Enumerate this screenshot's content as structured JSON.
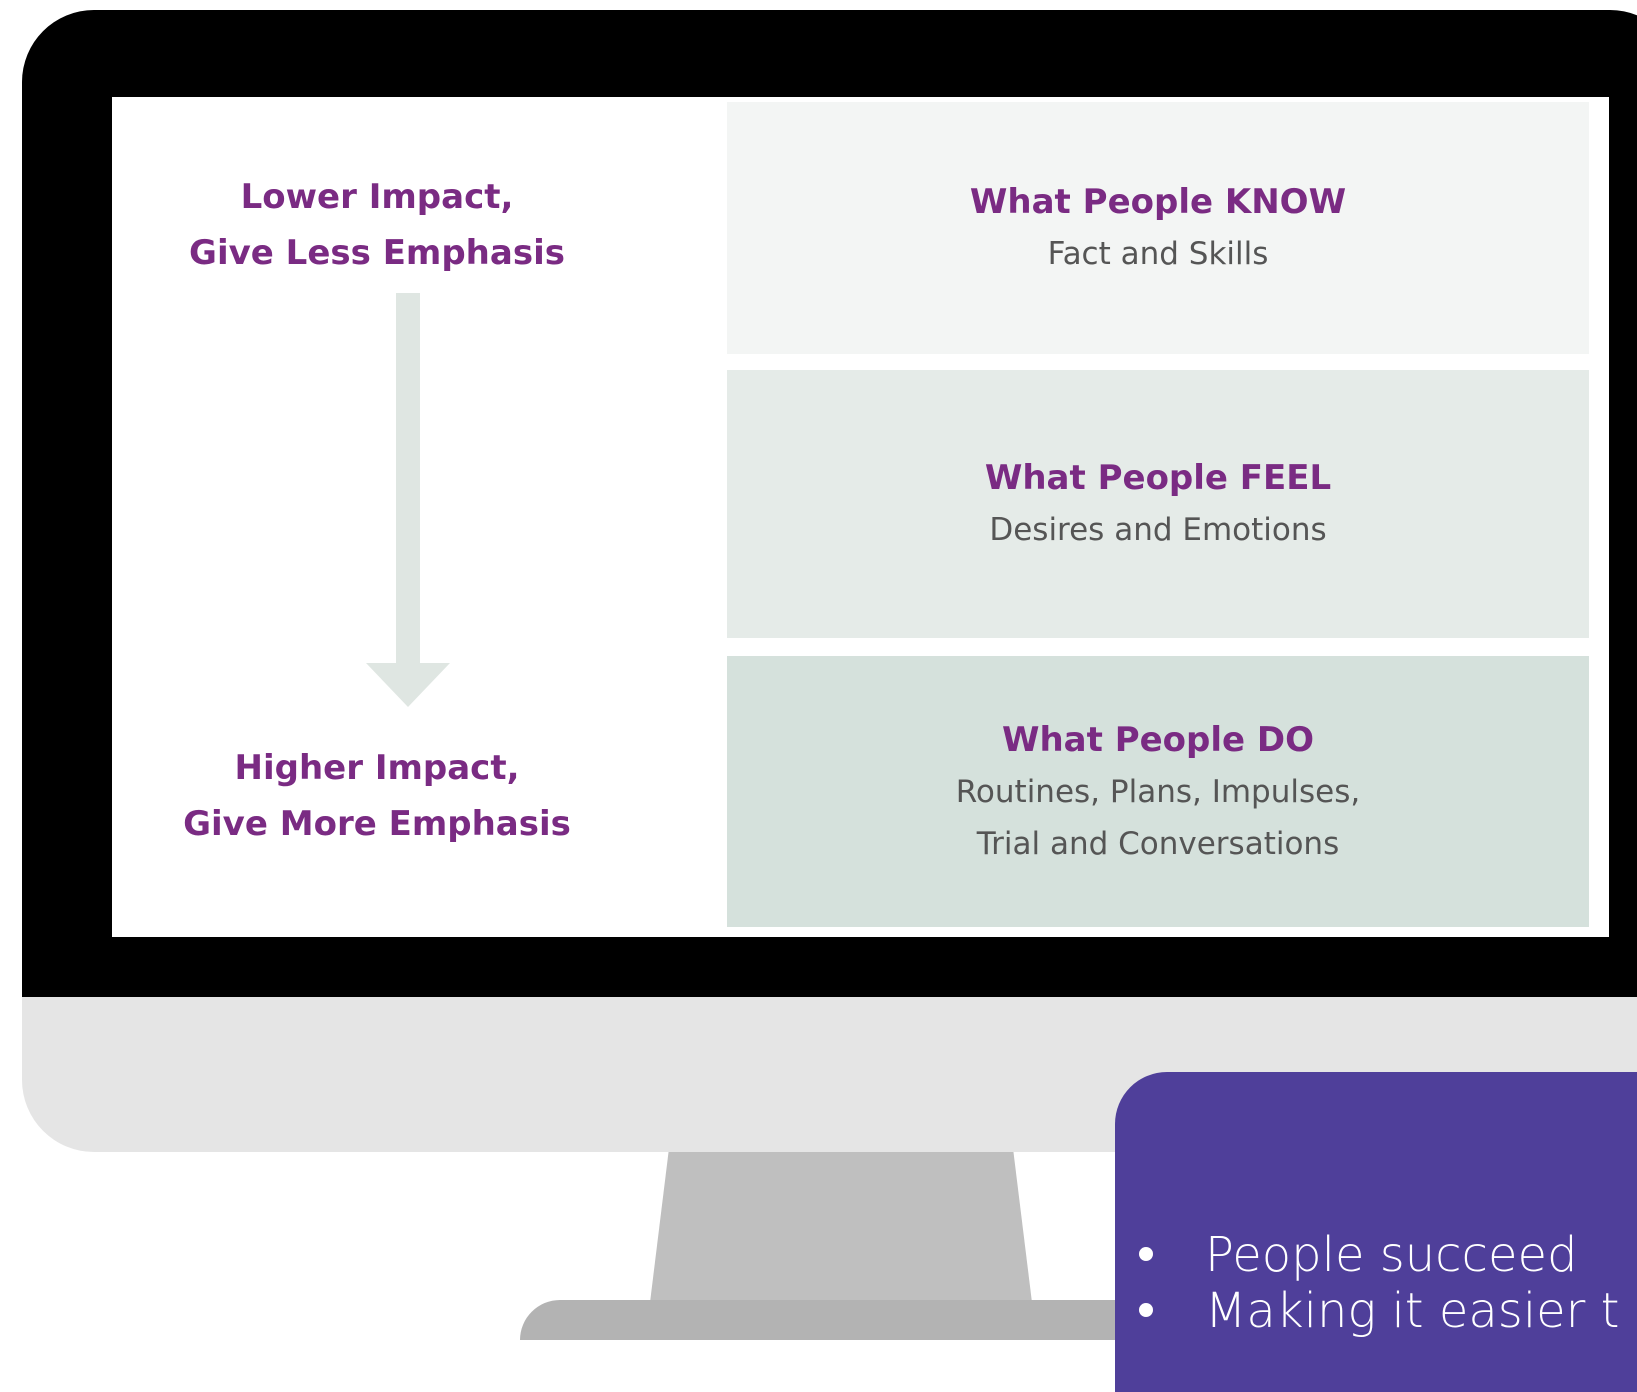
{
  "diagram": {
    "left_labels": {
      "top": [
        "Lower Impact,",
        "Give Less Emphasis"
      ],
      "bottom": [
        "Higher Impact,",
        "Give More Emphasis"
      ]
    },
    "bands": [
      {
        "title": "What People KNOW",
        "subtitle": [
          "Fact and Skills"
        ]
      },
      {
        "title": "What People FEEL",
        "subtitle": [
          "Desires and Emotions"
        ]
      },
      {
        "title": "What People DO",
        "subtitle": [
          "Routines, Plans, Impulses,",
          "Trial and Conversations"
        ]
      }
    ],
    "colors": {
      "title": "#7a2b83",
      "subtitle": "#555555",
      "band_know": "#f3f5f4",
      "band_feel": "#e5ebe8",
      "band_do": "#d5e1dc",
      "arrow": "#dfe6e2"
    }
  },
  "callout": {
    "items": [
      "People succeed",
      "Making it easier t"
    ],
    "color": "#4f3f9a"
  }
}
